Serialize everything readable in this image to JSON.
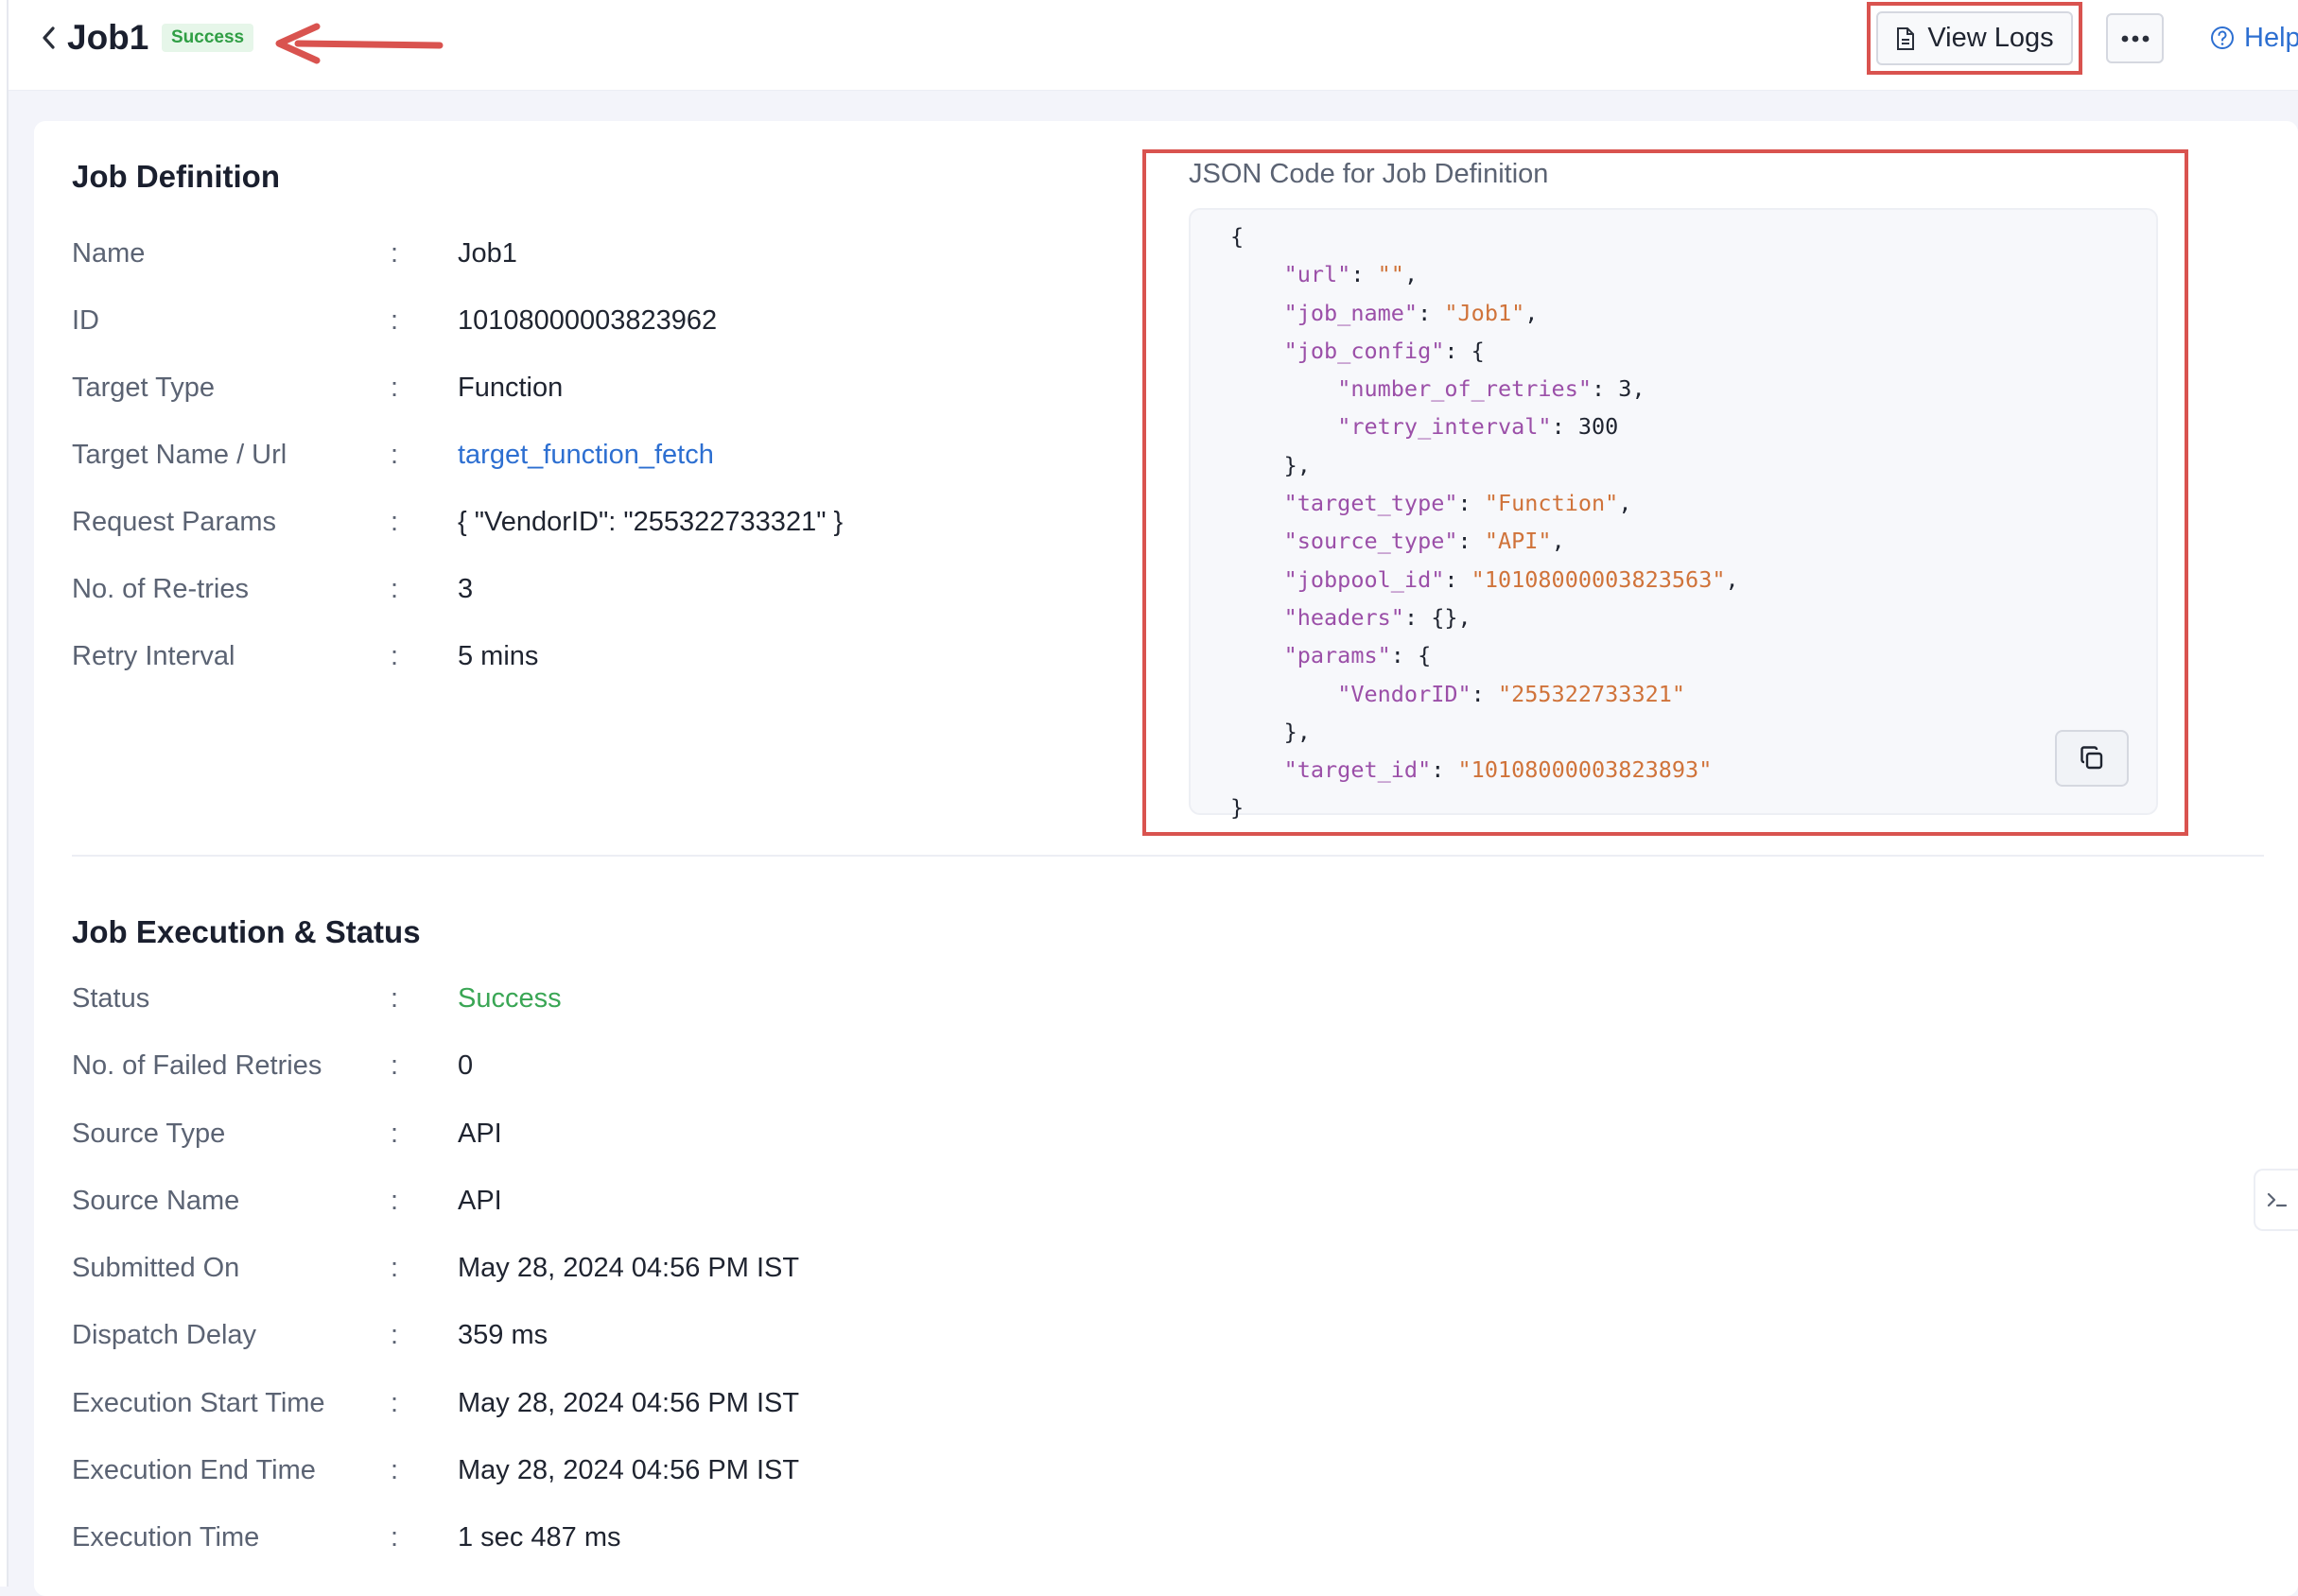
{
  "header": {
    "title": "Job1",
    "status_badge": "Success",
    "view_logs_label": "View Logs",
    "help_label": "Help"
  },
  "job_definition": {
    "title": "Job Definition",
    "rows": [
      {
        "label": "Name",
        "value": "Job1"
      },
      {
        "label": "ID",
        "value": "10108000003823962"
      },
      {
        "label": "Target Type",
        "value": "Function"
      },
      {
        "label": "Target Name / Url",
        "value": "target_function_fetch"
      },
      {
        "label": "Request Params",
        "value": "{ \"VendorID\": \"255322733321\" }"
      },
      {
        "label": "No. of Re-tries",
        "value": "3"
      },
      {
        "label": "Retry Interval",
        "value": "5 mins"
      }
    ]
  },
  "json_panel": {
    "title": "JSON Code for Job Definition",
    "lines": [
      {
        "ind": 0,
        "t": "{"
      },
      {
        "ind": 1,
        "k": "url",
        "v": "",
        "c": ","
      },
      {
        "ind": 1,
        "k": "job_name",
        "v": "Job1",
        "c": ","
      },
      {
        "ind": 1,
        "k": "job_config",
        "raw": "{"
      },
      {
        "ind": 2,
        "k": "number_of_retries",
        "raw": "3,"
      },
      {
        "ind": 2,
        "k": "retry_interval",
        "raw": "300"
      },
      {
        "ind": 1,
        "t": "},"
      },
      {
        "ind": 1,
        "k": "target_type",
        "v": "Function",
        "c": ","
      },
      {
        "ind": 1,
        "k": "source_type",
        "v": "API",
        "c": ","
      },
      {
        "ind": 1,
        "k": "jobpool_id",
        "v": "10108000003823563",
        "c": ","
      },
      {
        "ind": 1,
        "k": "headers",
        "raw": "{},"
      },
      {
        "ind": 1,
        "k": "params",
        "raw": "{"
      },
      {
        "ind": 2,
        "k": "VendorID",
        "v": "255322733321",
        "c": ""
      },
      {
        "ind": 1,
        "t": "},"
      },
      {
        "ind": 1,
        "k": "target_id",
        "v": "10108000003823893",
        "c": ""
      },
      {
        "ind": 0,
        "t": "}"
      }
    ]
  },
  "execution": {
    "title": "Job Execution & Status",
    "rows": [
      {
        "label": "Status",
        "value": "Success"
      },
      {
        "label": "No. of Failed Retries",
        "value": "0"
      },
      {
        "label": "Source Type",
        "value": "API"
      },
      {
        "label": "Source Name",
        "value": "API"
      },
      {
        "label": "Submitted On",
        "value": "May 28, 2024 04:56 PM IST"
      },
      {
        "label": "Dispatch Delay",
        "value": "359 ms"
      },
      {
        "label": "Execution Start Time",
        "value": "May 28, 2024 04:56 PM IST"
      },
      {
        "label": "Execution End Time",
        "value": "May 28, 2024 04:56 PM IST"
      },
      {
        "label": "Execution Time",
        "value": "1 sec 487 ms"
      }
    ]
  },
  "colors": {
    "success": "#3aa655",
    "link": "#2d6fd1",
    "annotation": "#d9534f",
    "json_key": "#9b4fa8",
    "json_string": "#d0733a"
  }
}
